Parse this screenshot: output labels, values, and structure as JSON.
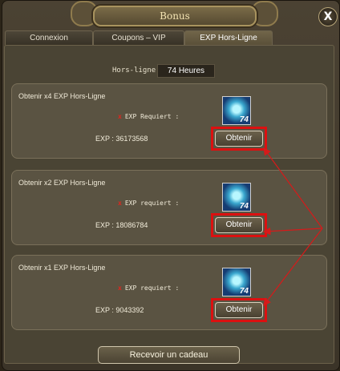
{
  "window": {
    "title": "Bonus",
    "close_label": "X"
  },
  "tabs": [
    "Connexion",
    "Coupons – VIP",
    "EXP Hors-Ligne"
  ],
  "hours": {
    "label": "Hors-ligne",
    "value": "74 Heures"
  },
  "offers": [
    {
      "title": "Obtenir x4 EXP Hors-Ligne",
      "mark": "x",
      "requirement": "EXP Requiert :",
      "exp": "EXP : 36173568",
      "button": "Obtenir",
      "count": "74"
    },
    {
      "title": "Obtenir x2 EXP Hors-Ligne",
      "mark": "x",
      "requirement": "EXP requiert :",
      "exp": "EXP : 18086784",
      "button": "Obtenir",
      "count": "74"
    },
    {
      "title": "Obtenir x1 EXP Hors-Ligne",
      "mark": "x",
      "requirement": "EXP requiert :",
      "exp": "EXP : 9043392",
      "button": "Obtenir",
      "count": "74"
    }
  ],
  "gift_button": "Recevoir un cadeau",
  "colors": {
    "highlight": "#dc1010",
    "arrow": "#d61a1a"
  }
}
